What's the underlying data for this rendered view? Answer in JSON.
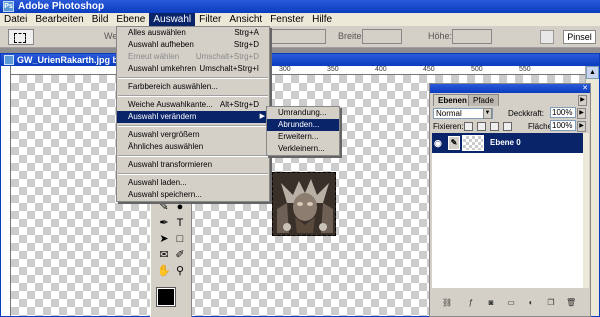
{
  "app": {
    "title": "Adobe Photoshop"
  },
  "menubar": [
    "Datei",
    "Bearbeiten",
    "Bild",
    "Ebene",
    "Auswahl",
    "Filter",
    "Ansicht",
    "Fenster",
    "Hilfe"
  ],
  "menubar_active": "Auswahl",
  "options": {
    "we_label": "We",
    "breite_label": "Breite:",
    "hoehe_label": "Höhe:",
    "pinsel_label": "Pinsel"
  },
  "document": {
    "title": "GW_UrienRakarth.jpg bei",
    "ruler_ticks": [
      "300",
      "350",
      "400",
      "450",
      "500",
      "550"
    ]
  },
  "auswahl_menu": {
    "items": [
      {
        "label": "Alles auswählen",
        "shortcut": "Strg+A",
        "disabled": false
      },
      {
        "label": "Auswahl aufheben",
        "shortcut": "Strg+D",
        "disabled": false
      },
      {
        "label": "Erneut wählen",
        "shortcut": "Umschalt+Strg+D",
        "disabled": true
      },
      {
        "label": "Auswahl umkehren",
        "shortcut": "Umschalt+Strg+I",
        "disabled": false
      },
      {
        "sep": true
      },
      {
        "label": "Farbbereich auswählen...",
        "shortcut": "",
        "disabled": false
      },
      {
        "sep": true
      },
      {
        "label": "Weiche Auswahlkante...",
        "shortcut": "Alt+Strg+D",
        "disabled": false
      },
      {
        "label": "Auswahl verändern",
        "shortcut": "",
        "disabled": false,
        "highlight": true,
        "submenu": true
      },
      {
        "sep": true
      },
      {
        "label": "Auswahl vergrößern",
        "shortcut": "",
        "disabled": false
      },
      {
        "label": "Ähnliches auswählen",
        "shortcut": "",
        "disabled": false
      },
      {
        "sep": true
      },
      {
        "label": "Auswahl transformieren",
        "shortcut": "",
        "disabled": false
      },
      {
        "sep": true
      },
      {
        "label": "Auswahl laden...",
        "shortcut": "",
        "disabled": false
      },
      {
        "label": "Auswahl speichern...",
        "shortcut": "",
        "disabled": false
      }
    ]
  },
  "submenu": {
    "items": [
      {
        "label": "Umrandung...",
        "highlight": false
      },
      {
        "label": "Abrunden...",
        "highlight": true
      },
      {
        "label": "Erweitern...",
        "highlight": false
      },
      {
        "label": "Verkleinern...",
        "highlight": false
      }
    ]
  },
  "layers": {
    "tabs": [
      "Ebenen",
      "Pfade"
    ],
    "blend_mode": "Normal",
    "opacity_label": "Deckkraft:",
    "opacity_value": "100%",
    "lock_label": "Fixieren:",
    "fill_label": "Fläche:",
    "fill_value": "100%",
    "layer_name": "Ebene 0"
  },
  "colors": {
    "title_bar": "#0a3cbf",
    "highlight": "#0a246a",
    "panel": "#d4d0c8"
  }
}
